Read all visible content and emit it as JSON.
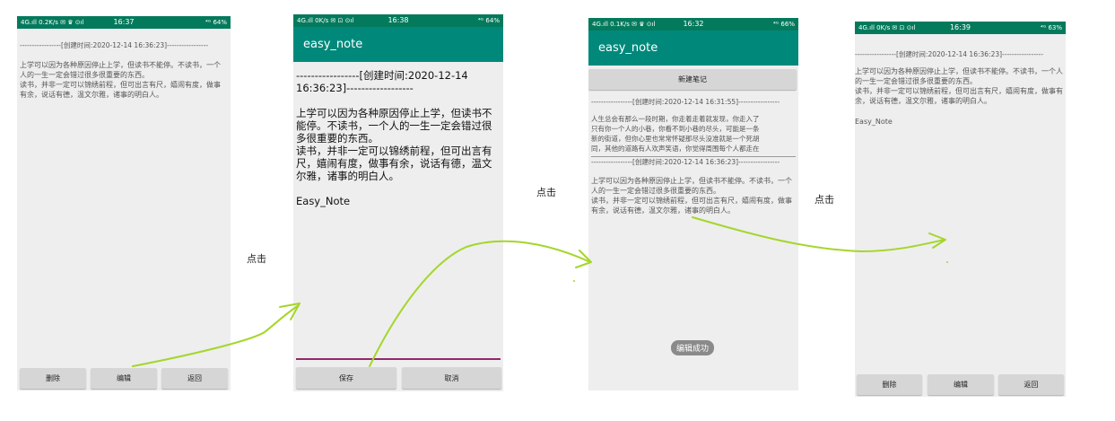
{
  "status": {
    "s1": {
      "left": "4G.ıll 0.2K/s ✉ ♛ ⊙ıl",
      "time": "16:37",
      "right": "⁴ᴳ 64%"
    },
    "s2": {
      "left": "4G.ıll 0K/s ✉ ⊡ ⊙ıl",
      "time": "16:38",
      "right": "⁴ᴳ 64%"
    },
    "s3": {
      "left": "4G.ıll 0.1K/s ✉ ♛ ⊙ıl",
      "time": "16:32",
      "right": "⁴ᴳ 66%"
    },
    "s4": {
      "left": "4G.ıll 0K/s ✉ ⊡ ⊙ıl",
      "time": "16:39",
      "right": "⁴ᴳ 63%"
    }
  },
  "note": {
    "header": "-----------------[创建时间:2020-12-14 16:36:23]-----------------",
    "line1": "上学可以因为各种原因停止上学，但读书不能停。不读书，一个人的一生一定会错过很多很重要的东西。",
    "line2": "读书，并非一定可以锦绣前程，但可出言有尺，嬉闹有度，做事有余，说话有德，温文尔雅，诸事的明白人。",
    "sig": "Easy_Note"
  },
  "screen1": {
    "buttons": {
      "delete": "删除",
      "edit": "编辑",
      "back": "返回"
    }
  },
  "screen2": {
    "title": "easy_note",
    "header1": "-----------------[创建时间:2020-12-14",
    "header2": "16:36:23]------------------",
    "sig": "Easy_Note",
    "buttons": {
      "save": "保存",
      "cancel": "取消"
    }
  },
  "screen3": {
    "title": "easy_note",
    "new_note_button": "新建笔记",
    "item1": {
      "header": "-----------------[创建时间:2020-12-14 16:31:55]-----------------",
      "l1": "人生总会有那么一段时期，你走着走着就发现，你走入了",
      "l2": "只有你一个人的小巷，你看不到小巷的尽头，可能是一条",
      "l3": "新的街道，但你心里也常常怀疑那尽头没准就是一个死胡",
      "l4": "同，其他的道路有人欢声笑语，你觉得周围每个人都走在"
    },
    "item2": {
      "header": "-----------------[创建时间:2020-12-14 16:36:23]-----------------"
    },
    "toast": "编辑成功"
  },
  "screen4": {
    "sig": "Easy_Note",
    "buttons": {
      "delete": "删除",
      "edit": "编辑",
      "back": "返回"
    }
  },
  "click_labels": [
    "点击",
    "点击",
    "点击"
  ],
  "colors": {
    "statusbar": "#047a5c",
    "appbar": "#00897b",
    "arrow": "#a4d62b",
    "editor_line": "#8e2a6a"
  }
}
